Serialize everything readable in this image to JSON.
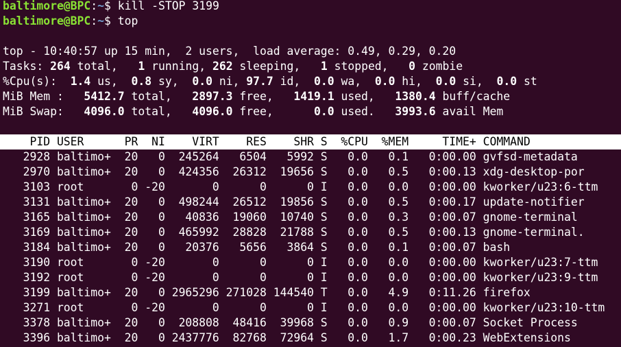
{
  "prompt": {
    "user_host": "baltimore@BPC",
    "sep": ":",
    "path": "~",
    "dollar": "$ "
  },
  "commands": [
    "kill -STOP 3199",
    "top"
  ],
  "top_header": {
    "line1": "top - 10:40:57 up 15 min,  2 users,  load average: 0.49, 0.29, 0.20",
    "tasks": {
      "label": "Tasks:",
      "total": "264",
      "total_label": " total,   ",
      "running": "1",
      "running_label": " running, ",
      "sleeping": "262",
      "sleeping_label": " sleeping,   ",
      "stopped": "1",
      "stopped_label": " stopped,   ",
      "zombie": "0",
      "zombie_label": " zombie"
    },
    "cpu": {
      "label": "%Cpu(s):  ",
      "us": "1.4",
      "us_label": " us,  ",
      "sy": "0.8",
      "sy_label": " sy,  ",
      "ni": "0.0",
      "ni_label": " ni, ",
      "id": "97.7",
      "id_label": " id,  ",
      "wa": "0.0",
      "wa_label": " wa,  ",
      "hi": "0.0",
      "hi_label": " hi,  ",
      "si": "0.0",
      "si_label": " si,  ",
      "st": "0.0",
      "st_label": " st"
    },
    "mem": {
      "label": "MiB Mem :   ",
      "total": "5412.7",
      "total_label": " total,   ",
      "free": "2897.3",
      "free_label": " free,   ",
      "used": "1419.1",
      "used_label": " used,   ",
      "buff": "1380.4",
      "buff_label": " buff/cache"
    },
    "swap": {
      "label": "MiB Swap:   ",
      "total": "4096.0",
      "total_label": " total,   ",
      "free": "4096.0",
      "free_label": " free,      ",
      "used": "0.0",
      "used_label": " used.   ",
      "avail": "3993.6",
      "avail_label": " avail Mem"
    }
  },
  "table_header": "    PID USER      PR  NI    VIRT    RES    SHR S  %CPU  %MEM     TIME+ COMMAND",
  "rows": [
    "   2928 baltimo+  20   0  245264   6504   5992 S   0.0   0.1   0:00.00 gvfsd-metadata",
    "   2970 baltimo+  20   0  424356  26312  19656 S   0.0   0.5   0:00.13 xdg-desktop-por",
    "   3103 root       0 -20       0      0      0 I   0.0   0.0   0:00.00 kworker/u23:6-ttm",
    "   3131 baltimo+  20   0  498244  26512  19856 S   0.0   0.5   0:00.17 update-notifier",
    "   3165 baltimo+  20   0   40836  19060  10740 S   0.0   0.3   0:00.07 gnome-terminal",
    "   3169 baltimo+  20   0  465992  28828  21788 S   0.0   0.5   0:00.13 gnome-terminal.",
    "   3184 baltimo+  20   0   20376   5656   3864 S   0.0   0.1   0:00.07 bash",
    "   3190 root       0 -20       0      0      0 I   0.0   0.0   0:00.00 kworker/u23:7-ttm",
    "   3192 root       0 -20       0      0      0 I   0.0   0.0   0:00.00 kworker/u23:9-ttm",
    "   3199 baltimo+  20   0 2965296 271028 144540 T   0.0   4.9   0:11.26 firefox",
    "   3271 root       0 -20       0      0      0 I   0.0   0.0   0:00.00 kworker/u23:10-ttm",
    "   3378 baltimo+  20   0  208808  48416  39968 S   0.0   0.9   0:00.07 Socket Process",
    "   3396 baltimo+  20   0 2437776  82768  72964 S   0.0   1.7   0:00.23 WebExtensions"
  ]
}
